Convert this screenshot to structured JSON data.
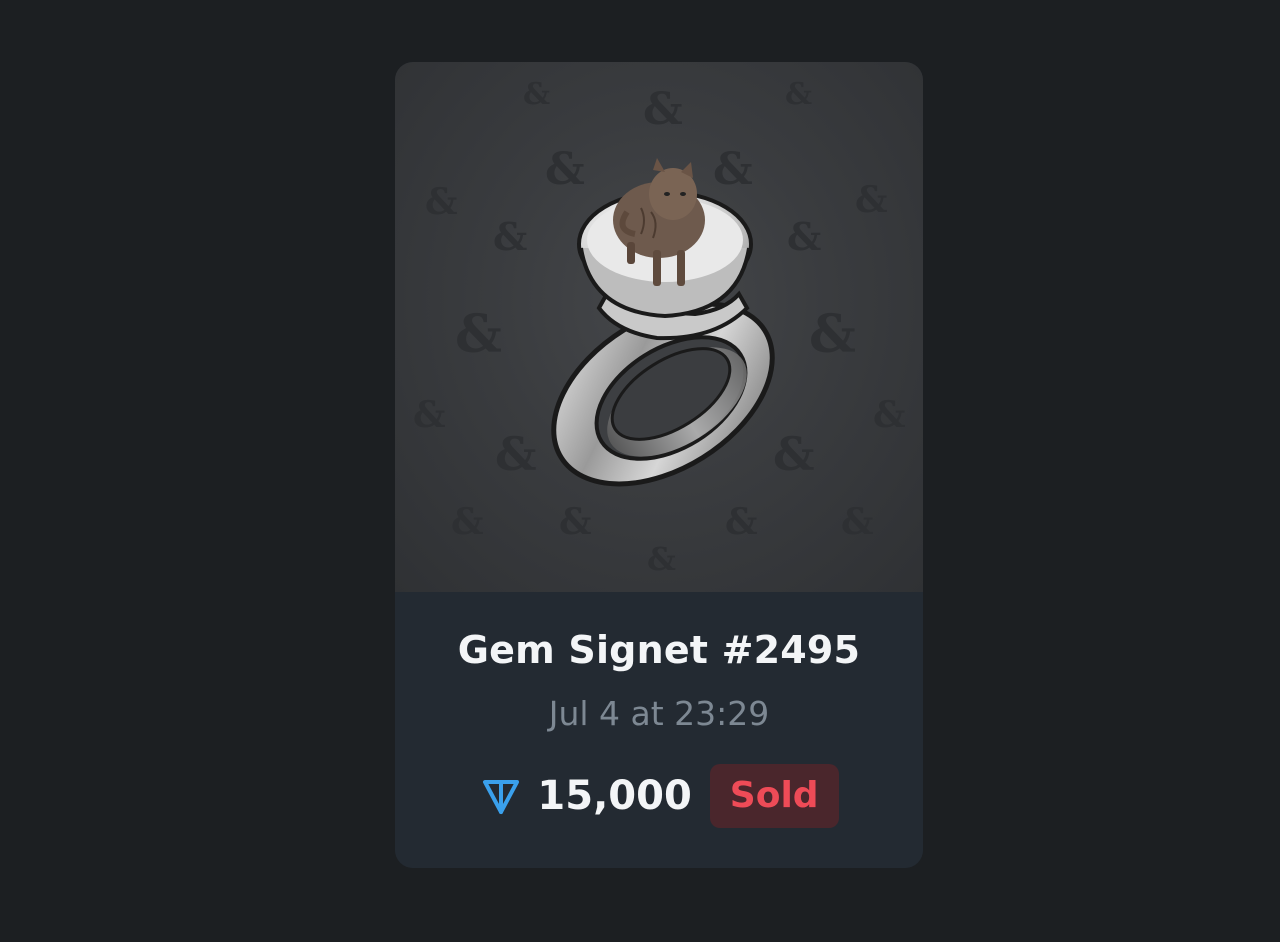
{
  "gift": {
    "title": "Gem Signet #2495",
    "date": "Jul 4 at 23:29",
    "price": "15,000",
    "currency_icon": "ton-icon",
    "status": "Sold"
  },
  "colors": {
    "background": "#1c1f22",
    "card": "#232a32",
    "accent_ton": "#3aa0ec",
    "sold_text": "#ee4b57",
    "sold_bg": "#4a262c"
  }
}
